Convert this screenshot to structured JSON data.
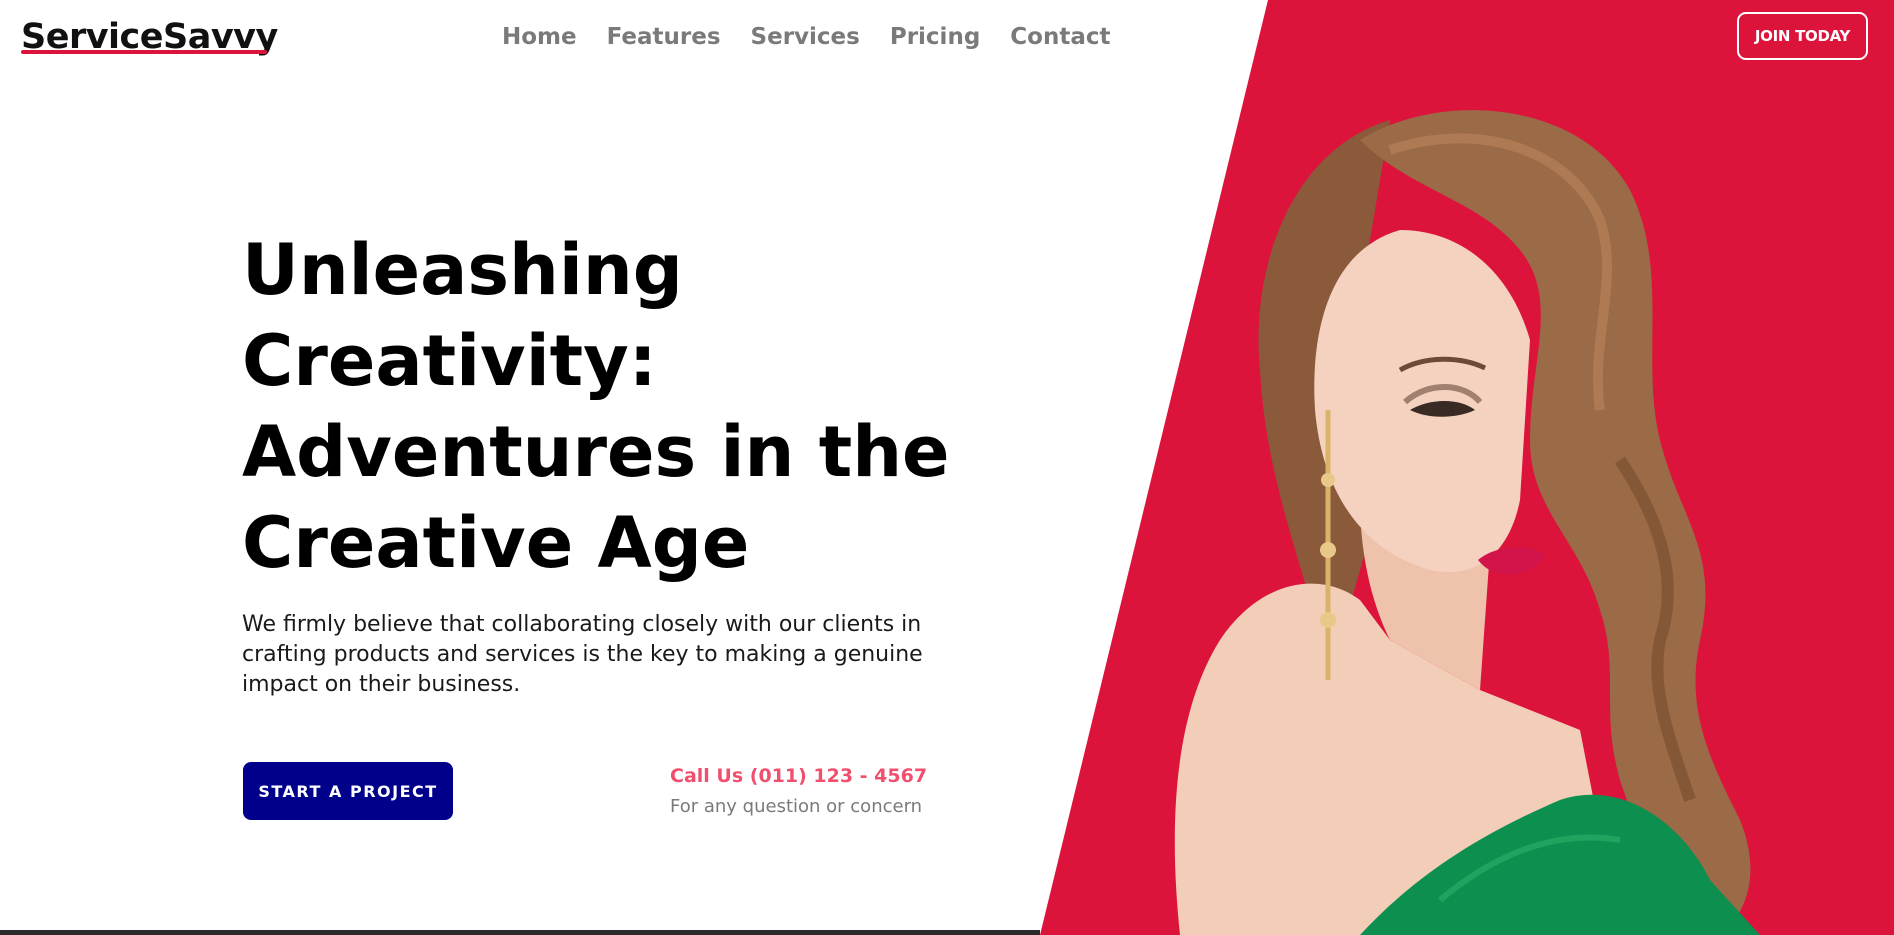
{
  "brand": {
    "logo_text": "ServiceSavvy"
  },
  "nav": {
    "items": [
      "Home",
      "Features",
      "Services",
      "Pricing",
      "Contact"
    ]
  },
  "header": {
    "join_label": "JOIN TODAY"
  },
  "hero": {
    "headline_lines": [
      "Unleashing",
      "Creativity:",
      "Adventures in the",
      "Creative Age"
    ],
    "lead_lines": [
      "We firmly believe that collaborating closely with our clients in",
      "crafting products and services is the key to making a genuine",
      "impact on their business."
    ],
    "cta_label": "START A PROJECT",
    "call_label": "Call Us (011) 123 - 4567",
    "call_sub": "For any question or concern"
  },
  "colors": {
    "accent_red": "#dc143c",
    "cta_blue": "#00008b",
    "call_pink": "#f0506e",
    "nav_gray": "#7a7a7a"
  }
}
